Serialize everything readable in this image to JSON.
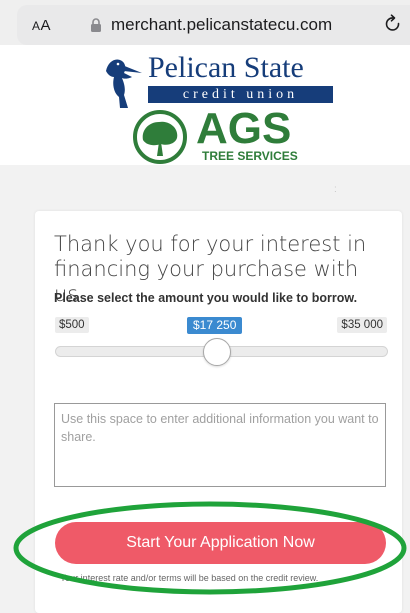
{
  "browser": {
    "text_size_label": "AA",
    "url": "merchant.pelicanstatecu.com",
    "lock_icon": "lock-icon",
    "reload_icon": "reload-icon"
  },
  "logos": {
    "pelican_name": "Pelican State",
    "pelican_tagline": "credit union",
    "ags_name": "AGS",
    "ags_tagline": "TREE SERVICES"
  },
  "form": {
    "title": "Thank you for your interest in financing your purchase with us.",
    "prompt": "Please select the amount you would like to borrow.",
    "min_label": "$500",
    "value_label": "$17 250",
    "max_label": "$35 000",
    "slider_min": 500,
    "slider_max": 35000,
    "slider_value": 17250,
    "textarea_placeholder": "Use this space to enter additional information you want to share.",
    "cta_label": "Start Your Application Now",
    "disclaimer": "Your interest rate and/or terms will be based on the credit review."
  },
  "colors": {
    "cta": "#ef5a68",
    "value_badge": "#3b8ad0",
    "highlight": "#1fa33a",
    "pelican_blue": "#163d7a",
    "ags_green": "#2f7d3a"
  }
}
